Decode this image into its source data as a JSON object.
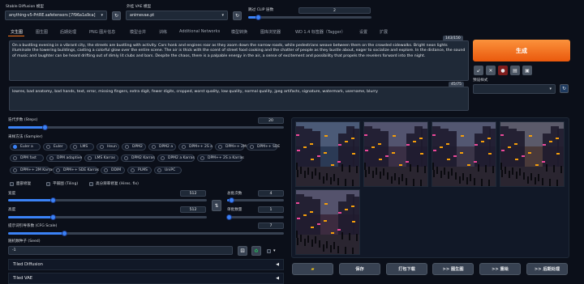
{
  "header": {
    "sd_model_label": "Stable Diffusion 模型",
    "sd_model_value": "anything-v5-PrtRE.safetensors [7f96a1a9ca]",
    "vae_label": "外挂 VAE 模型",
    "vae_value": "animevae.pt",
    "clip_skip_label": "跳过 CLIP 层数",
    "clip_skip_value": "2",
    "clip_skip_fraction": 0.083
  },
  "tabs": [
    "文生图",
    "图生图",
    "后期处理",
    "PNG 图片信息",
    "模型合并",
    "训练",
    "Additional Networks",
    "模型转换",
    "图库浏览器",
    "WD 1.4 标签器（Tagger）",
    "设置",
    "扩展"
  ],
  "prompt": {
    "text": "On a bustling evening in a vibrant city, the streets are bustling with activity. Cars honk and engines roar as they zoom down the narrow roads, while pedestrians weave between them on the crowded sidewalks. Bright neon lights illuminate the towering buildings, casting a colorful glow over the entire scene. The air is thick with the scent of street food cooking and the chatter of people as they bustle about, eager to socialize and explore. In the distance, the sound of music and laughter can be heard drifting out of dimly lit clubs and bars. Despite the chaos, there is a palpable energy in the air, a sense of excitement and possibility that propels the revelers forward into the night.",
    "counter": "143/150"
  },
  "negative_prompt": {
    "text": "lowres, bad anatomy, bad hands, text, error, missing fingers, extra digit, fewer digits, cropped, worst quality, low quality, normal quality, jpeg artifacts, signature, watermark, username, blurry",
    "counter": "45/75"
  },
  "generate_label": "生成",
  "styles_label": "预设样式",
  "steps": {
    "label": "迭代步数 (Steps)",
    "value": "20",
    "fraction": 0.13
  },
  "sampler": {
    "label": "采样方法 (Sampler)",
    "options": [
      "Euler a",
      "Euler",
      "LMS",
      "Heun",
      "DPM2",
      "DPM2 a",
      "DPM++ 2S a",
      "DPM++ 2M",
      "DPM++ SDE",
      "DPM fast",
      "DPM adaptive",
      "LMS Karras",
      "DPM2 Karras",
      "DPM2 a Karras",
      "DPM++ 2S a Karras",
      "DPM++ 2M Karras",
      "DPM++ SDE Karras",
      "DDIM",
      "PLMS",
      "UniPC"
    ],
    "selected": "Euler a"
  },
  "checkboxes": {
    "face_restore": "面部修复",
    "tiling": "平铺图 (Tiling)",
    "hires_fix": "高分辨率修复 (Hires. fix)"
  },
  "width": {
    "label": "宽度",
    "value": "512",
    "fraction": 0.22
  },
  "height": {
    "label": "高度",
    "value": "512",
    "fraction": 0.22
  },
  "batch_count": {
    "label": "总批次数",
    "value": "4",
    "fraction": 0.03
  },
  "batch_size": {
    "label": "单批数量",
    "value": "1",
    "fraction": 0.0
  },
  "cfg": {
    "label": "提示词引导系数 (CFG Scale)",
    "value": "7",
    "fraction": 0.2
  },
  "seed": {
    "label": "随机数种子 (Seed)",
    "value": "-1"
  },
  "accordions": [
    "Tiled Diffusion",
    "Tiled VAE"
  ],
  "actions": [
    "保存",
    "打包下载",
    ">> 图生图",
    ">> 重绘",
    ">> 后期处理"
  ],
  "icons": {
    "refresh": "refresh-icon",
    "folder": "folder-icon",
    "dice": "dice-icon",
    "recycle": "recycle-icon",
    "arrow": "arrow-icon",
    "trash": "trash-icon",
    "paste": "paste-icon",
    "save_style": "save-style-icon"
  },
  "colors": {
    "accent": "#f97316",
    "primary": "#3b82f6",
    "background": "#0b0f19"
  }
}
